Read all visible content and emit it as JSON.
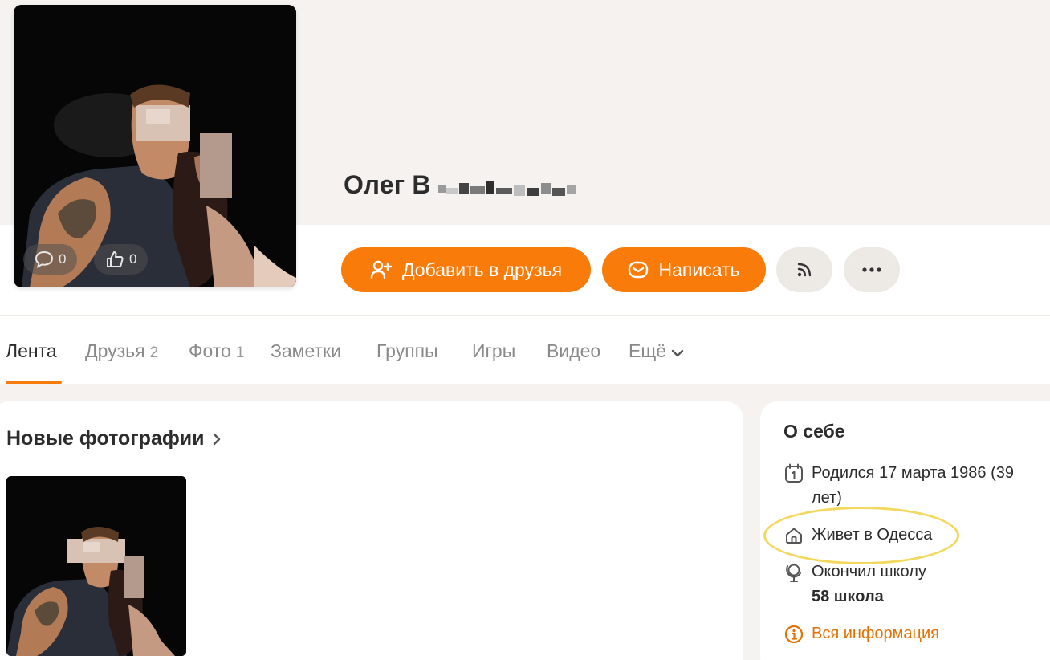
{
  "profile": {
    "name": "Олег В",
    "avatar_stats": {
      "comments": "0",
      "likes": "0"
    }
  },
  "actions": {
    "add_friend": "Добавить в друзья",
    "write": "Написать"
  },
  "tabs": [
    {
      "label": "Лента",
      "count": ""
    },
    {
      "label": "Друзья",
      "count": "2"
    },
    {
      "label": "Фото",
      "count": "1"
    },
    {
      "label": "Заметки",
      "count": ""
    },
    {
      "label": "Группы",
      "count": ""
    },
    {
      "label": "Игры",
      "count": ""
    },
    {
      "label": "Видео",
      "count": ""
    },
    {
      "label": "Ещё",
      "count": ""
    }
  ],
  "photos_section": {
    "title": "Новые фотографии"
  },
  "about": {
    "title": "О себе",
    "birth": "Родился 17 марта 1986 (39 лет)",
    "city": "Живет в Одесса",
    "school_prefix": "Окончил школу",
    "school_name": "58 школа",
    "all_info": "Вся информация"
  },
  "colors": {
    "accent": "#f97b0a",
    "highlight": "#f2d85e",
    "link": "#e27205"
  }
}
